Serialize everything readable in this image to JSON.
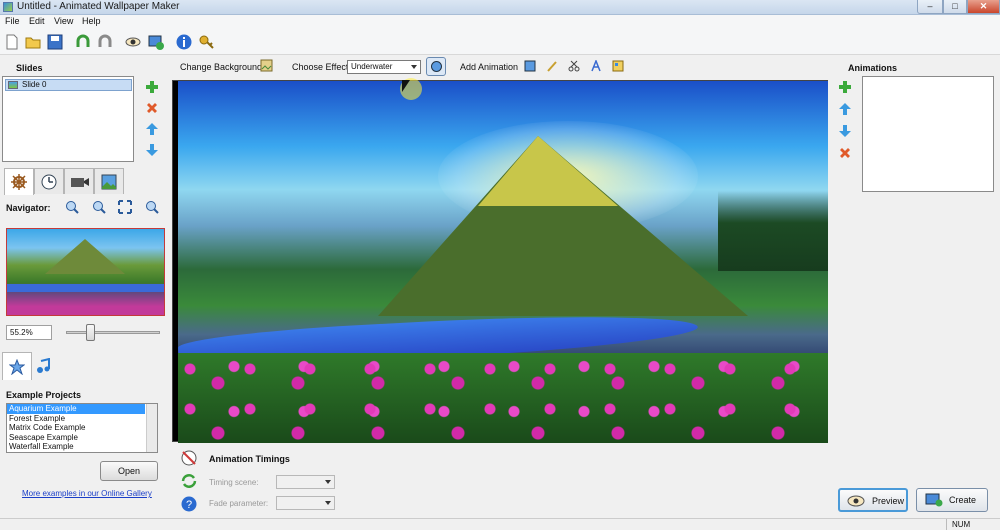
{
  "window": {
    "title": "Untitled - Animated Wallpaper Maker",
    "minimize": "–",
    "maximize": "□",
    "close": "✕"
  },
  "menu": [
    "File",
    "Edit",
    "View",
    "Help"
  ],
  "toolbar_icons": [
    "new-file-icon",
    "open-folder-icon",
    "save-icon",
    "undo-icon",
    "redo-icon",
    "preview-eye-icon",
    "export-icon",
    "info-icon",
    "key-icon"
  ],
  "slides": {
    "title": "Slides",
    "items": [
      "Slide 0"
    ]
  },
  "navigator": {
    "label": "Navigator:",
    "zoom": "55.2%",
    "zoom_fraction": 0.24
  },
  "examples": {
    "title": "Example Projects",
    "items": [
      "Aquarium Example",
      "Forest Example",
      "Matrix Code Example",
      "Seascape Example",
      "Waterfall Example"
    ],
    "selected": 0,
    "open_button": "Open",
    "gallery_link": "More examples in our Online Gallery"
  },
  "effect_bar": {
    "change_background": "Change Background",
    "choose_effect": "Choose Effect:",
    "effect_value": "Underwater",
    "add_animation": "Add Animation"
  },
  "timings": {
    "title": "Animation Timings",
    "timing_scene": "Timing scene:",
    "fade_parameter": "Fade parameter:"
  },
  "animations": {
    "title": "Animations"
  },
  "actions": {
    "preview": "Preview",
    "create": "Create"
  },
  "status": {
    "num": "NUM"
  }
}
